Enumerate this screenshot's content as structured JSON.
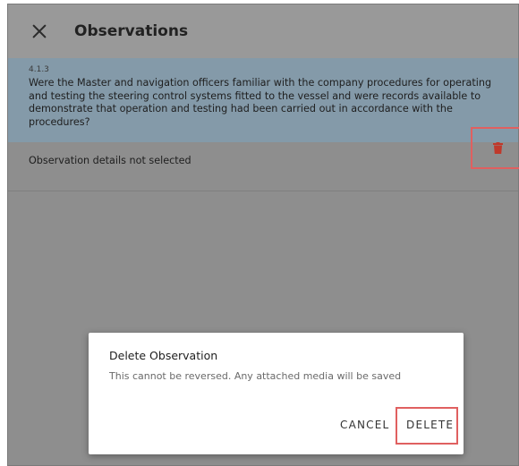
{
  "header": {
    "close_icon": "close-icon",
    "title": "Observations"
  },
  "question": {
    "number": "4.1.3",
    "text": "Were the Master and navigation officers familiar with the company procedures for operating and testing the steering control systems fitted to the vessel and were records available to demonstrate that operation and testing had been carried out in accordance with the procedures?"
  },
  "observation": {
    "status_text": "Observation details not selected",
    "delete_icon": "trash-icon",
    "delete_icon_color": "#c0392b"
  },
  "dialog": {
    "title": "Delete Observation",
    "message": "This cannot be reversed. Any attached media will be saved",
    "cancel_label": "CANCEL",
    "delete_label": "DELETE"
  },
  "colors": {
    "highlight_border": "#e06060",
    "question_background": "#849aa9",
    "overlay_background": "#8e8e8e"
  }
}
